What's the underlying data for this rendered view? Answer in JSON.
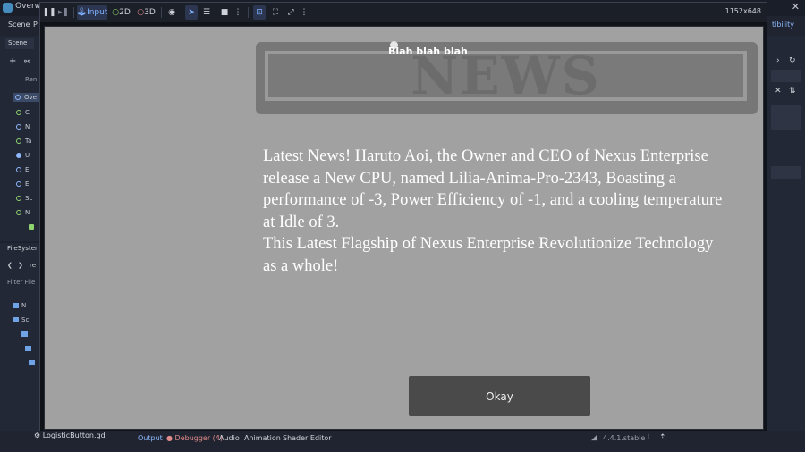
{
  "editor": {
    "window_title": "Overw",
    "menu": [
      "Scene",
      "P"
    ],
    "right_menu": "tibility",
    "scene_dock": {
      "tab": "Scene",
      "rename_label": "Ren",
      "items": [
        "Ove",
        "C",
        "N",
        "Ta",
        "U",
        "E",
        "E",
        "Sc",
        "N"
      ]
    },
    "filesystem_dock": {
      "tab": "FileSystem",
      "path": "re",
      "filter": "Filter File",
      "rows": [
        "N",
        "Sc"
      ]
    },
    "bottom_bar": {
      "open_file": "LogisticButton.gd",
      "tabs": [
        "Output",
        "Debugger (4)",
        "Audio",
        "Animation",
        "Shader Editor"
      ],
      "version": "4.4.1.stable"
    }
  },
  "game_toolbar": {
    "input_label": "Input",
    "mode_2d": "2D",
    "mode_3d": "3D",
    "resolution": "1152x648"
  },
  "game": {
    "banner_word": "NEWS",
    "title": "Blah blah blah",
    "article_lines": [
      "Latest News! Haruto Aoi, the Owner and CEO of Nexus Enterprise release a New CPU, named Lilia-Anima-Pro-2343, Boasting a performance of -3, Power Efficiency of -1, and a cooling temperature at Idle of 3.",
      "This Latest Flagship of Nexus Enterprise Revolutionize Technology as a whole!"
    ],
    "button_label": "Okay"
  },
  "colors": {
    "viewport_bg": "#a1a1a1",
    "banner": "#777777",
    "button": "#4a4a4a",
    "editor_accent": "#7fb2ff"
  }
}
